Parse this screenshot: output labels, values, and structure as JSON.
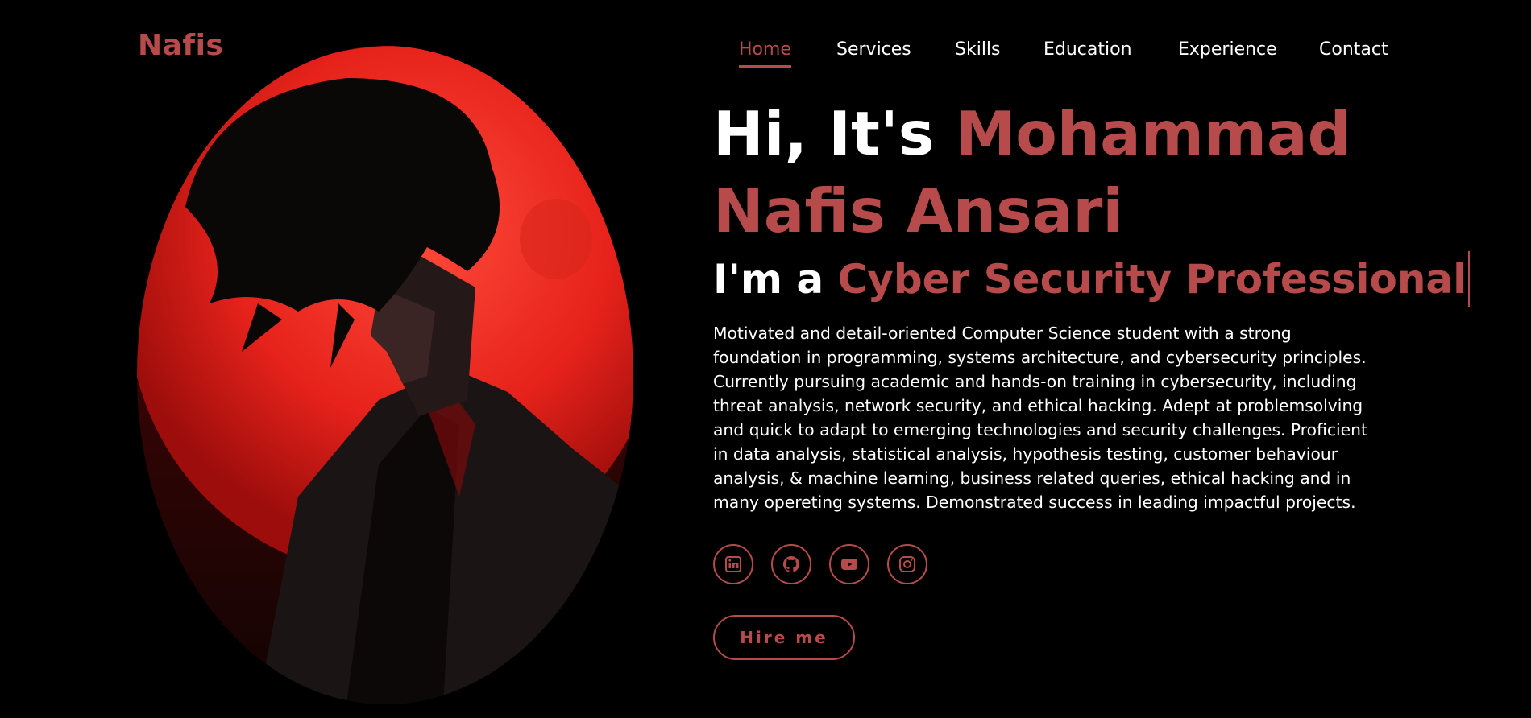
{
  "header": {
    "logo": "Nafis",
    "nav": [
      {
        "label": "Home",
        "active": true
      },
      {
        "label": "Services",
        "active": false
      },
      {
        "label": "Skills",
        "active": false
      },
      {
        "label": "Education",
        "active": false
      },
      {
        "label": "Experience",
        "active": false
      },
      {
        "label": "Contact",
        "active": false
      }
    ]
  },
  "hero": {
    "greeting": "Hi, It's",
    "name": "Mohammad Nafis Ansari",
    "role_prefix": "I'm a",
    "role": "Cyber Security Professional",
    "bio": "Motivated and detail-oriented Computer Science student with a strong foundation in programming, systems architecture, and cybersecurity principles. Currently pursuing academic and hands-on training in cybersecurity, including threat analysis, network security, and ethical hacking. Adept at problemsolving and quick to adapt to emerging technologies and security challenges. Proficient in data analysis, statistical analysis, hypothesis testing, customer behaviour analysis, & machine learning, business related queries, ethical hacking and in many opereting systems. Demonstrated success in leading impactful projects.",
    "hire_label": "Hire me"
  },
  "socials": [
    {
      "icon": "linkedin-icon"
    },
    {
      "icon": "github-icon"
    },
    {
      "icon": "youtube-icon"
    },
    {
      "icon": "instagram-icon"
    }
  ],
  "colors": {
    "accent": "#b74b4b",
    "background": "#000000",
    "text": "#ffffff"
  }
}
